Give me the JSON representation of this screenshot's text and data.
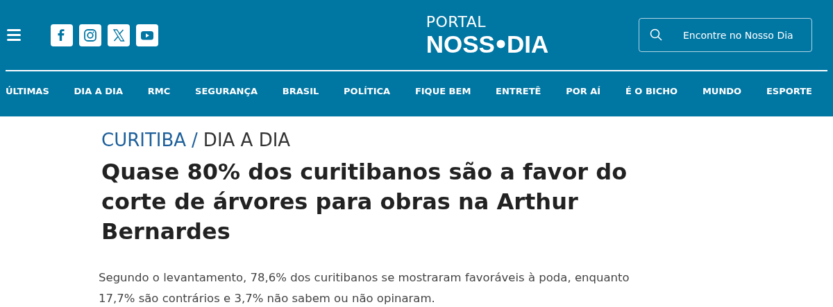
{
  "header": {
    "social": [
      {
        "kind": "facebook"
      },
      {
        "kind": "instagram"
      },
      {
        "kind": "x"
      },
      {
        "kind": "youtube"
      }
    ],
    "logo": {
      "top": "PORTAL",
      "left": "NOSS",
      "right": "DIA"
    },
    "search": {
      "placeholder": "Encontre no Nosso Dia"
    }
  },
  "nav": [
    {
      "label": "ÚLTIMAS"
    },
    {
      "label": "DIA A DIA"
    },
    {
      "label": "RMC"
    },
    {
      "label": "SEGURANÇA"
    },
    {
      "label": "BRASIL"
    },
    {
      "label": "POLÍTICA"
    },
    {
      "label": "FIQUE BEM"
    },
    {
      "label": "ENTRETÊ"
    },
    {
      "label": "POR AÍ"
    },
    {
      "label": "É O BICHO"
    },
    {
      "label": "MUNDO"
    },
    {
      "label": "ESPORTE"
    }
  ],
  "article": {
    "breadcrumb": {
      "section": "CURITIBA",
      "separator": "/",
      "subsection": "DIA A DIA"
    },
    "headline": "Quase 80% dos curitibanos são a favor do corte de árvores para obras na Arthur Bernardes",
    "summary": "Segundo o levantamento, 78,6% dos curitibanos se mostraram favoráveis à poda, enquanto 17,7% são contrários e 3,7% não sabem ou não opinaram."
  }
}
